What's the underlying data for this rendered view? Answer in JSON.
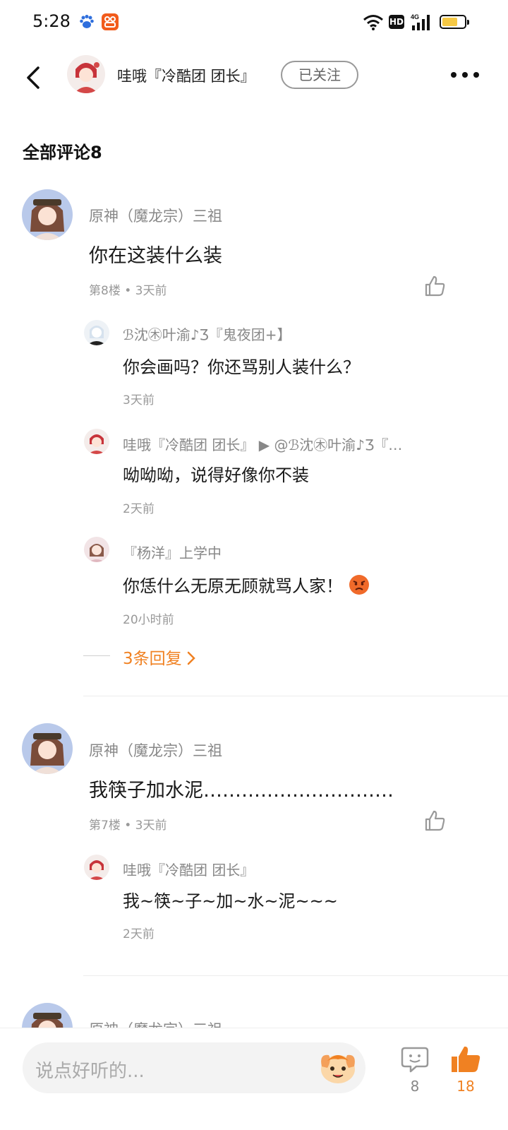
{
  "status_bar": {
    "time": "5:28",
    "hd": "HD",
    "network": "4G",
    "battery_level": 0.7
  },
  "header": {
    "username": "哇哦『冷酷团 团长』",
    "follow_label": "已关注"
  },
  "section_title": "全部评论8",
  "comments": [
    {
      "author": "原神（魔龙宗）三祖",
      "text": "你在这装什么装",
      "meta": "第8楼 • 3天前",
      "replies": [
        {
          "author": "ℬ沈㊍叶渝♪Ʒ『鬼夜团+】",
          "text": "你会画吗？你还骂别人装什么？",
          "time": "3天前"
        },
        {
          "author": "哇哦『冷酷团 团长』 ▶ @ℬ沈㊍叶渝♪Ʒ『…",
          "text": "呦呦呦，说得好像你不装",
          "time": "2天前"
        },
        {
          "author": "『杨洋』上学中",
          "text": "你恁什么无原无顾就骂人家！",
          "time": "20小时前"
        }
      ],
      "more_replies": "3条回复"
    },
    {
      "author": "原神（魔龙宗）三祖",
      "text": "我筷子加水泥…………………………",
      "meta": "第7楼 • 3天前",
      "replies": [
        {
          "author": "哇哦『冷酷团 团长』",
          "text": "我~筷~子~加~水~泥~~~",
          "time": "2天前"
        }
      ]
    },
    {
      "author": "原神（魔龙宗）三祖"
    }
  ],
  "bottom_bar": {
    "placeholder": "说点好听的...",
    "comment_count": "8",
    "like_count": "18"
  },
  "colors": {
    "accent": "#f08122",
    "text": "#1a1a1a",
    "muted": "#888888"
  }
}
